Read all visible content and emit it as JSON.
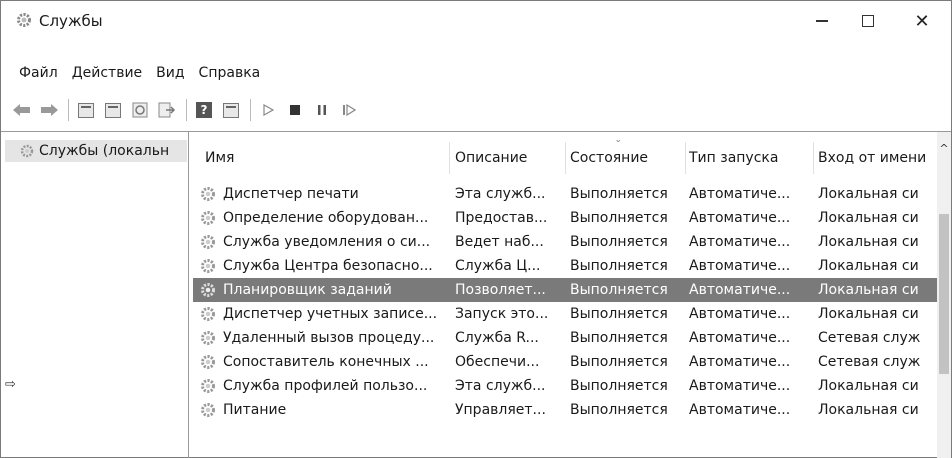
{
  "window": {
    "title": "Службы"
  },
  "menu": [
    "Файл",
    "Действие",
    "Вид",
    "Справка"
  ],
  "tree": {
    "root_label": "Службы (локальн"
  },
  "table": {
    "columns": [
      "Имя",
      "Описание",
      "Состояние",
      "Тип запуска",
      "Вход от имени"
    ],
    "rows": [
      {
        "name": "Диспетчер печати",
        "desc": "Эта служб...",
        "state": "Выполняется",
        "type": "Автоматиче...",
        "login": "Локальная си"
      },
      {
        "name": "Определение оборудован...",
        "desc": "Предостав...",
        "state": "Выполняется",
        "type": "Автоматиче...",
        "login": "Локальная си"
      },
      {
        "name": "Служба уведомления о си...",
        "desc": "Ведет наб...",
        "state": "Выполняется",
        "type": "Автоматиче...",
        "login": "Локальная си"
      },
      {
        "name": "Служба Центра безопасно...",
        "desc": "Служба Ц...",
        "state": "Выполняется",
        "type": "Автоматиче...",
        "login": "Локальная си"
      },
      {
        "name": "Планировщик заданий",
        "desc": "Позволяет...",
        "state": "Выполняется",
        "type": "Автоматиче...",
        "login": "Локальная си",
        "selected": true
      },
      {
        "name": "Диспетчер учетных записе...",
        "desc": "Запуск это...",
        "state": "Выполняется",
        "type": "Автоматиче...",
        "login": "Локальная си"
      },
      {
        "name": "Удаленный вызов процеду...",
        "desc": "Служба R...",
        "state": "Выполняется",
        "type": "Автоматиче...",
        "login": "Сетевая служ"
      },
      {
        "name": "Сопоставитель конечных ...",
        "desc": "Обеспечи...",
        "state": "Выполняется",
        "type": "Автоматиче...",
        "login": "Сетевая служ"
      },
      {
        "name": "Служба профилей пользо...",
        "desc": "Эта служб...",
        "state": "Выполняется",
        "type": "Автоматиче...",
        "login": "Локальная си"
      },
      {
        "name": "Питание",
        "desc": "Управляет...",
        "state": "Выполняется",
        "type": "Автоматиче...",
        "login": "Локальная си"
      }
    ]
  },
  "toolbar_icons": [
    "back-arrow-icon",
    "forward-arrow-icon",
    "console-tree-icon",
    "properties-icon",
    "refresh-icon",
    "export-icon",
    "help-icon",
    "view-icon",
    "play-icon",
    "stop-icon",
    "pause-icon",
    "restart-icon"
  ],
  "colors": {
    "selected_row": "#7a7a7a",
    "tree_selected": "#e5e5e5"
  }
}
